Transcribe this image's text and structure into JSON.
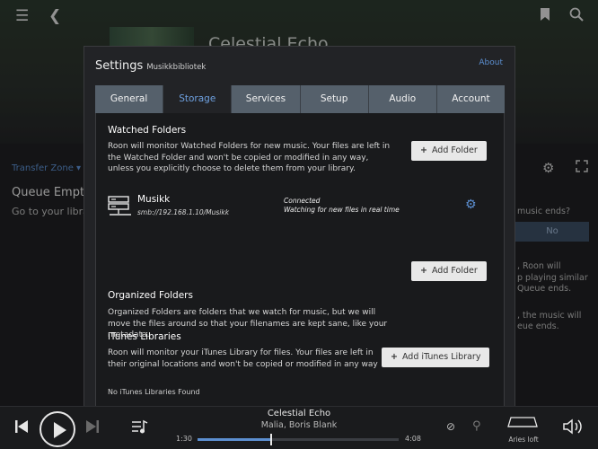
{
  "app": {
    "bg_title": "Celestial Echo",
    "transfer_zone": "Transfer Zone ▾",
    "queue_empty": "Queue Empty",
    "queue_sub": "Go to your library",
    "right_text_1": "music ends?",
    "right_no": "No",
    "right_text_2a": ", Roon will",
    "right_text_2b": "p playing similar",
    "right_text_2c": "Queue ends.",
    "right_text_3a": ", the music will",
    "right_text_3b": "eue ends."
  },
  "dialog": {
    "title": "Settings",
    "subtitle": "Musikkbibliotek",
    "about": "About",
    "tabs": [
      {
        "label": "General"
      },
      {
        "label": "Storage"
      },
      {
        "label": "Services"
      },
      {
        "label": "Setup"
      },
      {
        "label": "Audio"
      },
      {
        "label": "Account"
      }
    ],
    "watched": {
      "title": "Watched Folders",
      "desc": "Roon will monitor Watched Folders for new music. Your files are left in the Watched Folder and won't be copied or modified in any way, unless you explicitly choose to delete them from your library.",
      "button": "Add Folder"
    },
    "folder": {
      "name": "Musikk",
      "path": "smb://192.168.1.10/Musikk",
      "status": "Connected",
      "status2": "Watching for new files in real time"
    },
    "organized": {
      "title": "Organized Folders",
      "desc": "Organized Folders are folders that we watch for music, but we will move the files around so that your filenames are kept sane, like your metadata.",
      "button": "Add Folder"
    },
    "itunes": {
      "title": "iTunes Libraries",
      "desc": "Roon will monitor your iTunes Library for files. Your files are left in their original locations and won't be copied or modified in any way",
      "button": "Add iTunes Library",
      "empty": "No iTunes Libraries Found"
    }
  },
  "player": {
    "title": "Celestial Echo",
    "artist": "Malia, Boris Blank",
    "elapsed": "1:30",
    "total": "4:08",
    "progress": 0.36,
    "zone": "Aries loft"
  },
  "colors": {
    "accent": "#5c8fd1",
    "tab_bar": "#55606b",
    "dialog_bg": "#222326"
  }
}
